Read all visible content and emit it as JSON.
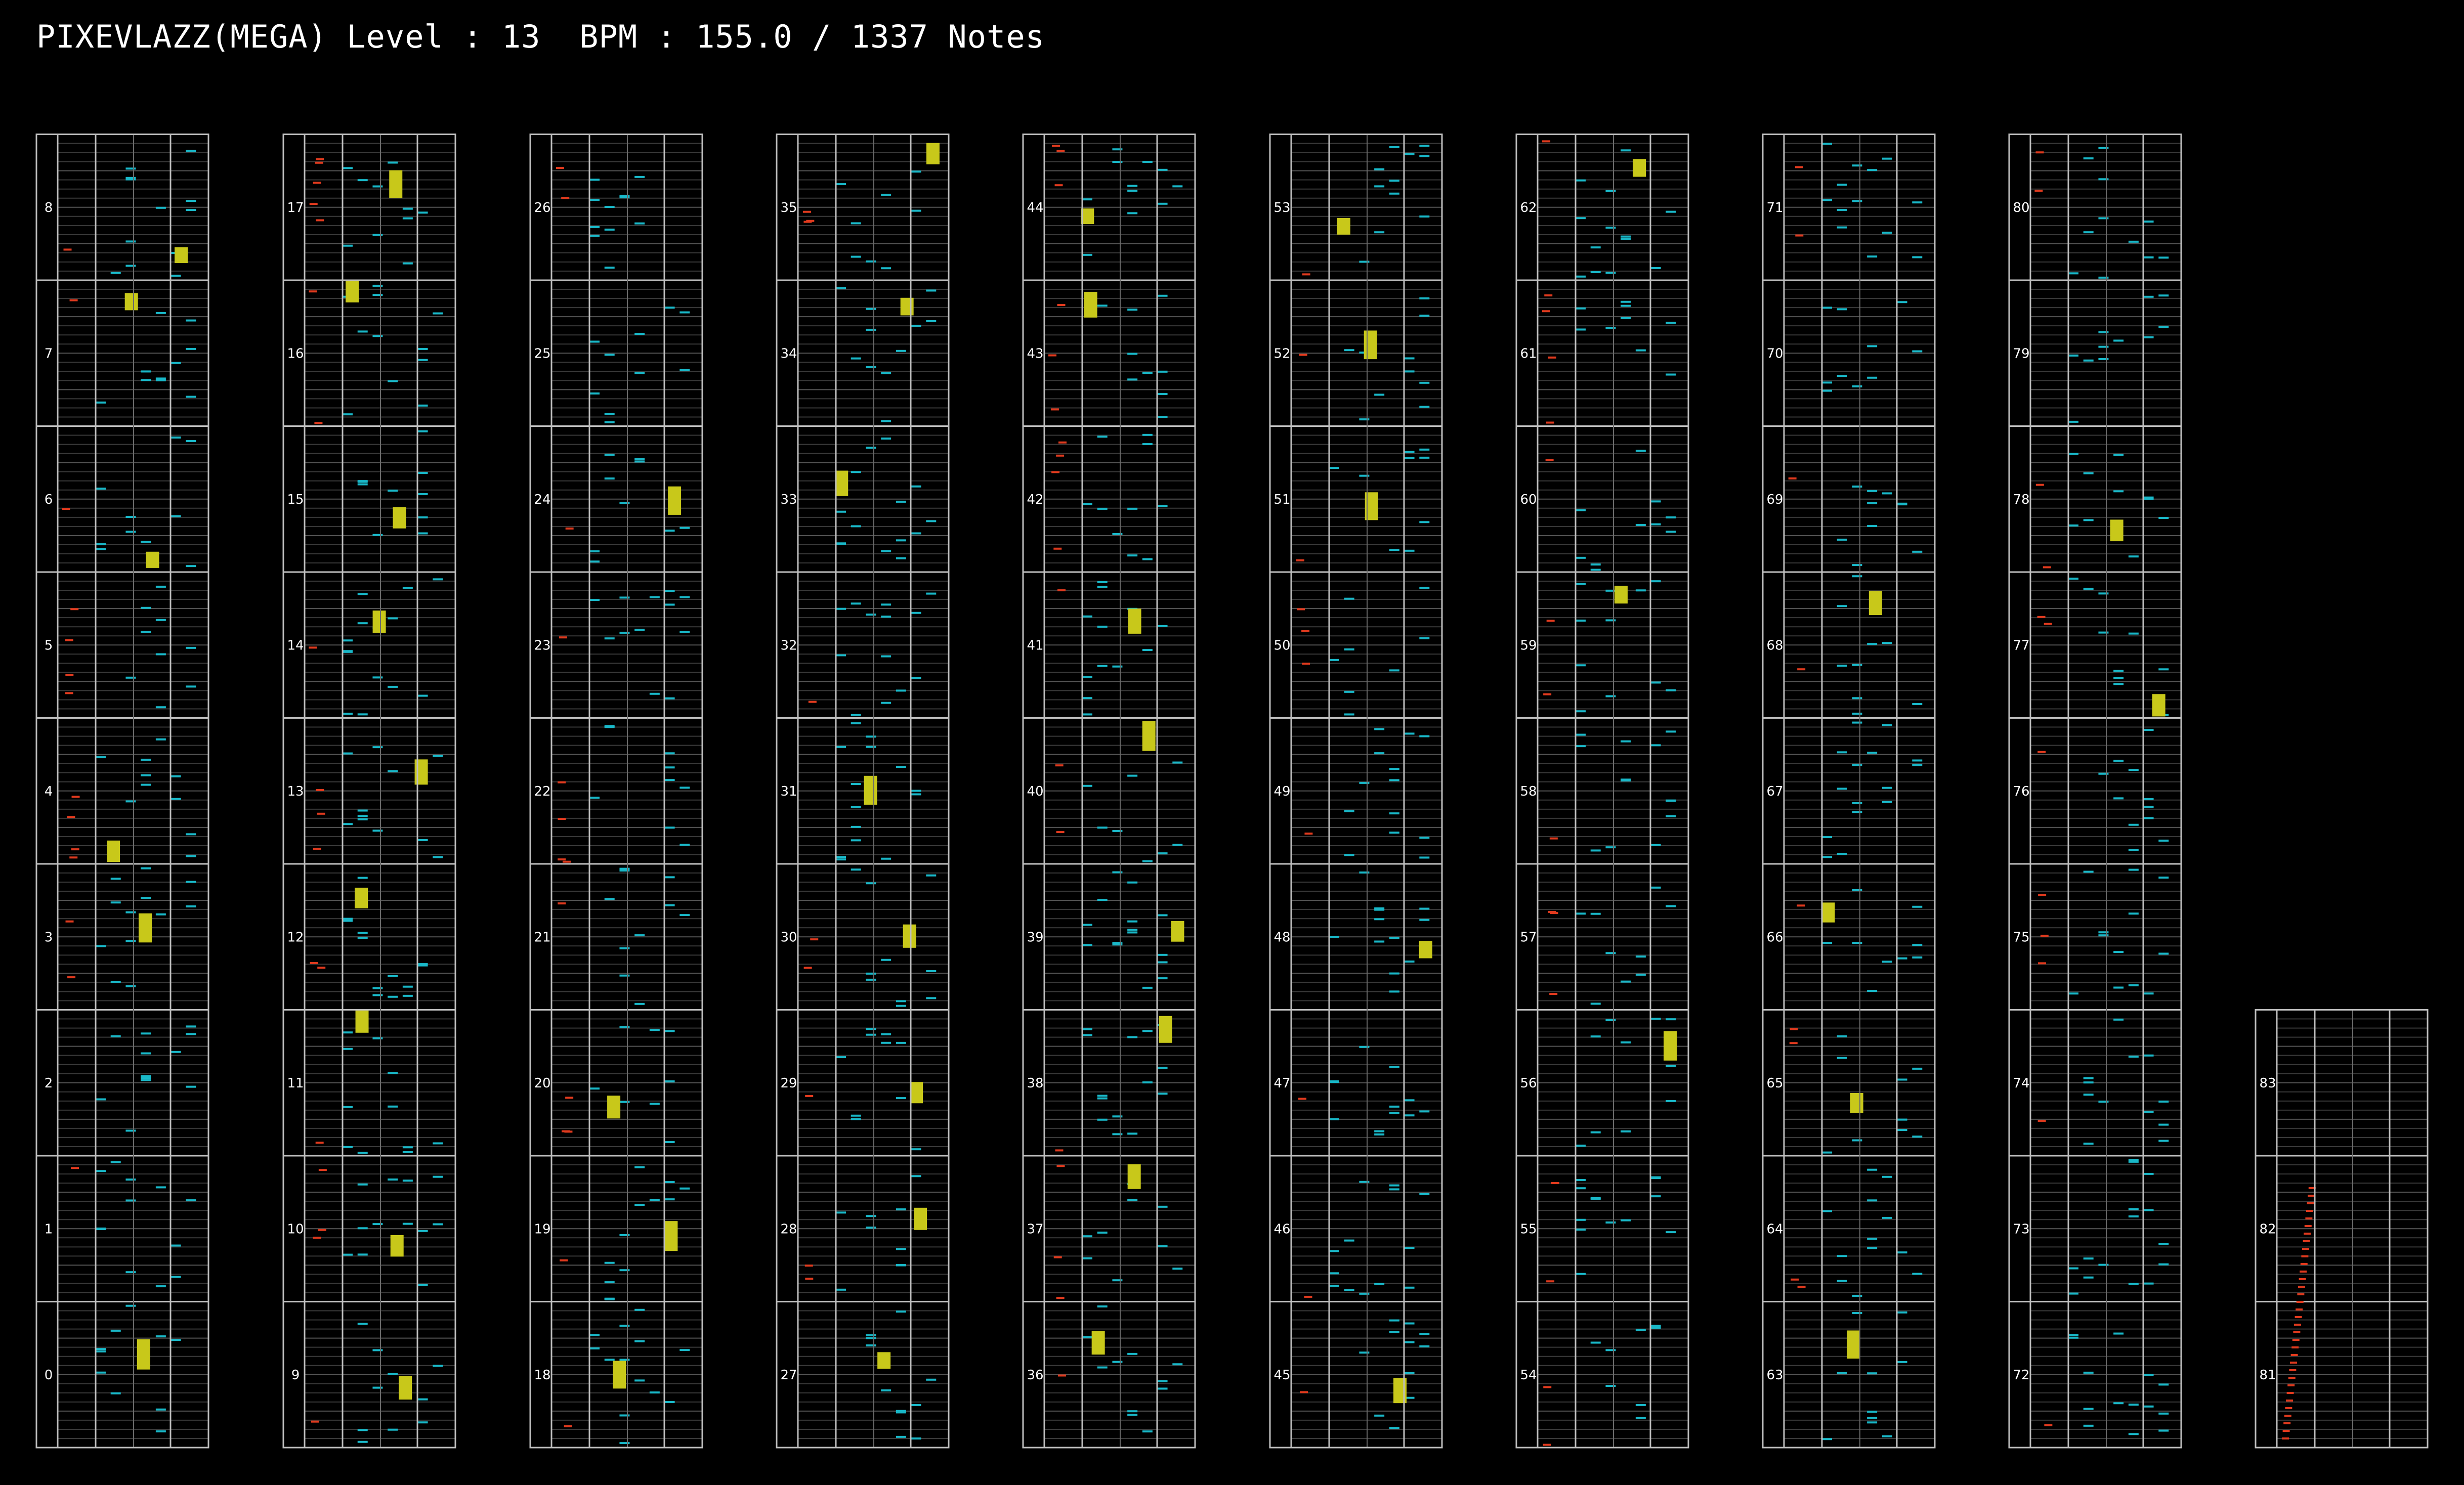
{
  "header": {
    "song": "PIXEVLAZZ(MEGA)",
    "level_label": "Level",
    "level": "13",
    "bpm_label": "BPM",
    "bpm": "155.0",
    "notes_label": "Notes",
    "notes": "1337",
    "title_text": "PIXEVLAZZ(MEGA) Level : 13  BPM : 155.0 / 1337 Notes"
  },
  "colors": {
    "background": "#000000",
    "border": "#bfbfbf",
    "grid": "#3a3a3a",
    "lane_line": "#6a6a6a",
    "tap_note": "#19b8c8",
    "scratch_note": "#e03a1e",
    "long_note": "#c8c81a",
    "mine_note": "#e8c840"
  },
  "chart_data": {
    "type": "table",
    "columns": [
      {
        "measures": [
          "0",
          "1",
          "2",
          "3",
          "4",
          "5",
          "6",
          "7",
          "8"
        ]
      },
      {
        "measures": [
          "9",
          "10",
          "11",
          "12",
          "13",
          "14",
          "15",
          "16",
          "17"
        ]
      },
      {
        "measures": [
          "18",
          "19",
          "20",
          "21",
          "22",
          "23",
          "24",
          "25",
          "26"
        ]
      },
      {
        "measures": [
          "27",
          "28",
          "29",
          "30",
          "31",
          "32",
          "33",
          "34",
          "35"
        ]
      },
      {
        "measures": [
          "36",
          "37",
          "38",
          "39",
          "40",
          "41",
          "42",
          "43",
          "44"
        ]
      },
      {
        "measures": [
          "45",
          "46",
          "47",
          "48",
          "49",
          "50",
          "51",
          "52",
          "53"
        ]
      },
      {
        "measures": [
          "54",
          "55",
          "56",
          "57",
          "58",
          "59",
          "60",
          "61",
          "62"
        ]
      },
      {
        "measures": [
          "63",
          "64",
          "65",
          "66",
          "67",
          "68",
          "69",
          "70",
          "71"
        ]
      },
      {
        "measures": [
          "72",
          "73",
          "74",
          "75",
          "76",
          "77",
          "78",
          "79",
          "80"
        ]
      },
      {
        "measures": [
          "81",
          "82",
          "83"
        ]
      }
    ],
    "legend": []
  }
}
